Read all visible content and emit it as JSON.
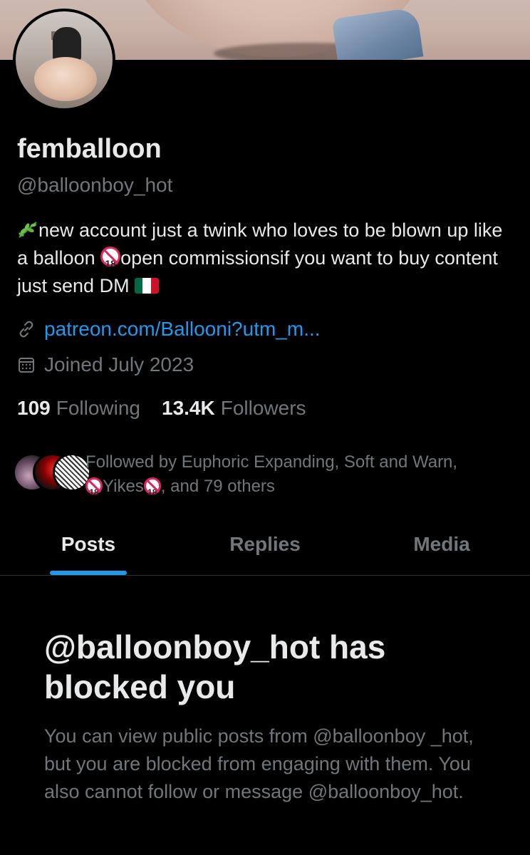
{
  "profile": {
    "display_name": "femballoon",
    "handle": "@balloonboy_hot",
    "bio": {
      "part1": "new account just a twink who loves to be blown up like a balloon ",
      "part2": "open commissionsif you want to buy content just send DM ",
      "age_badge": "18"
    },
    "link": "patreon.com/Ballooni?utm_m...",
    "joined": "Joined July 2023",
    "following_count": "109",
    "following_label": "Following",
    "followers_count": "13.4K",
    "followers_label": "Followers"
  },
  "followed_by": {
    "prefix": "Followed by Euphoric Expanding, Soft and Warn,",
    "name3": "Yikes",
    "suffix": ", and 79 others",
    "badge": "18"
  },
  "tabs": [
    {
      "label": "Posts",
      "active": true
    },
    {
      "label": "Replies",
      "active": false
    },
    {
      "label": "Media",
      "active": false
    }
  ],
  "blocked_notice": {
    "title": "@balloonboy_hot has blocked you",
    "body": "You can view public posts from @balloonboy _hot, but you are blocked from engaging with them. You also cannot follow or message @balloonboy_hot."
  },
  "colors": {
    "background": "#000000",
    "text_primary": "#e7e9ea",
    "text_secondary": "#71767b",
    "accent": "#1d9bf0",
    "divider": "#2f3336"
  },
  "icons": [
    "herb-icon",
    "no-under-18-icon",
    "mexico-flag-icon",
    "link-icon",
    "calendar-icon"
  ]
}
